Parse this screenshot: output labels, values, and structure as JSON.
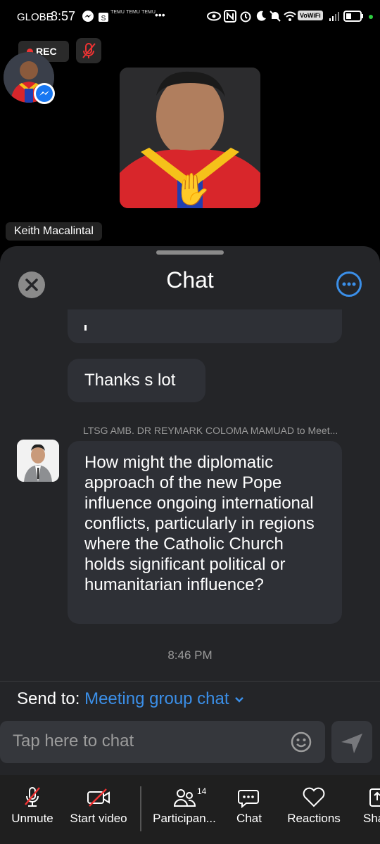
{
  "status_bar": {
    "carrier": "GLOBE",
    "time": "8:57",
    "badge_text": "TEMU",
    "vowifi": "VoWiFi",
    "more": "•••"
  },
  "meeting": {
    "rec_label": "REC",
    "participant_name": "Keith Macalintal",
    "raised_hand": "✋"
  },
  "chat": {
    "title": "Chat",
    "messages": [
      {
        "text": "Thanks s lot"
      },
      {
        "sender": "LTSG AMB. DR REYMARK COLOMA MAMUAD to Meet...",
        "text": "How might the diplomatic approach of the new Pope influence ongoing international conflicts, particularly in regions where the Catholic Church holds significant political or humanitarian influence?"
      }
    ],
    "timestamp": "8:46 PM",
    "send_to_label": "Send to:",
    "send_to_target": "Meeting group chat",
    "input_placeholder": "Tap here to chat"
  },
  "toolbar": {
    "unmute": "Unmute",
    "start_video": "Start video",
    "participants": "Participan...",
    "participants_count": "14",
    "chat": "Chat",
    "reactions": "Reactions",
    "share": "Sha"
  },
  "colors": {
    "accent": "#3b8fe8",
    "sheet_bg": "#242528",
    "bubble_bg": "#2e3036",
    "rec_dot": "#ee3333"
  }
}
